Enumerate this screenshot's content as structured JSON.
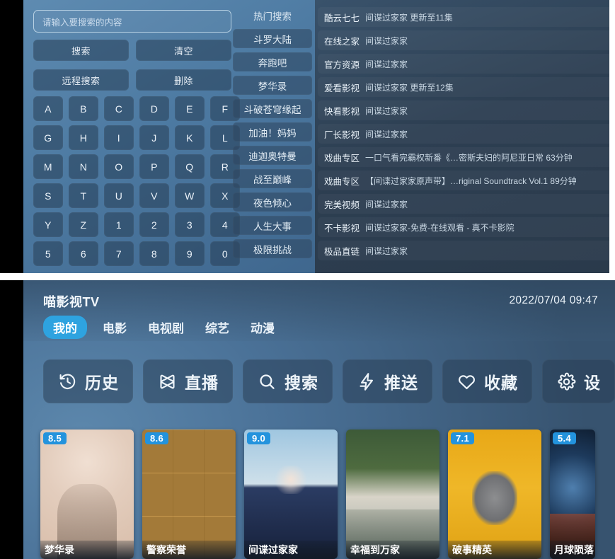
{
  "search_screen": {
    "input": {
      "placeholder": "请输入要搜索的内容",
      "value": ""
    },
    "buttons": [
      {
        "label": "搜索",
        "name": "search-button"
      },
      {
        "label": "清空",
        "name": "clear-button"
      },
      {
        "label": "远程搜索",
        "name": "remote-search-button"
      },
      {
        "label": "删除",
        "name": "delete-button"
      }
    ],
    "keypad": [
      "A",
      "B",
      "C",
      "D",
      "E",
      "F",
      "G",
      "H",
      "I",
      "J",
      "K",
      "L",
      "M",
      "N",
      "O",
      "P",
      "Q",
      "R",
      "S",
      "T",
      "U",
      "V",
      "W",
      "X",
      "Y",
      "Z",
      "1",
      "2",
      "3",
      "4",
      "5",
      "6",
      "7",
      "8",
      "9",
      "0"
    ],
    "hot_search": {
      "title": "热门搜索",
      "items": [
        "斗罗大陆",
        "奔跑吧",
        "梦华录",
        "斗破苍穹缘起",
        "加油！妈妈",
        "迪迦奥特曼",
        "战至巅峰",
        "夜色倾心",
        "人生大事",
        "极限挑战"
      ]
    },
    "results": [
      {
        "source": "酷云七七",
        "title": "间谍过家家  更新至11集"
      },
      {
        "source": "在线之家",
        "title": "间谍过家家"
      },
      {
        "source": "官方资源",
        "title": "间谍过家家"
      },
      {
        "source": "爱看影视",
        "title": "间谍过家家  更新至12集"
      },
      {
        "source": "快看影视",
        "title": "间谍过家家"
      },
      {
        "source": "厂长影视",
        "title": "间谍过家家"
      },
      {
        "source": "戏曲专区",
        "title": "一口气看完霸权新番《…密斯夫妇的阿尼亚日常  63分钟"
      },
      {
        "source": "戏曲专区",
        "title": "【间谍过家家原声带】…riginal Soundtrack Vol.1  89分钟"
      },
      {
        "source": "完美视频",
        "title": "间谍过家家"
      },
      {
        "source": "不卡影视",
        "title": "间谍过家家-免费-在线观看 - 真不卡影院"
      },
      {
        "source": "极品直链",
        "title": "间谍过家家"
      }
    ]
  },
  "tv_home": {
    "app_title": "喵影视TV",
    "clock": "2022/07/04 09:47",
    "tabs": [
      {
        "label": "我的",
        "active": true
      },
      {
        "label": "电影",
        "active": false
      },
      {
        "label": "电视剧",
        "active": false
      },
      {
        "label": "综艺",
        "active": false
      },
      {
        "label": "动漫",
        "active": false
      }
    ],
    "actions": [
      {
        "label": "历史",
        "icon": "history-icon"
      },
      {
        "label": "直播",
        "icon": "live-broadcast-icon"
      },
      {
        "label": "搜索",
        "icon": "search-icon"
      },
      {
        "label": "推送",
        "icon": "push-lightning-icon"
      },
      {
        "label": "收藏",
        "icon": "heart-icon"
      },
      {
        "label": "设",
        "icon": "gear-icon"
      }
    ],
    "posters": [
      {
        "score": "8.5",
        "title": "梦华录",
        "art": "art-menghualu"
      },
      {
        "score": "8.6",
        "title": "警察荣誉",
        "art": "art-jingcha"
      },
      {
        "score": "9.0",
        "title": "间谍过家家",
        "art": "art-spy"
      },
      {
        "score": "",
        "title": "幸福到万家",
        "art": "art-xingfu"
      },
      {
        "score": "7.1",
        "title": "破事精英",
        "art": "art-poshi"
      },
      {
        "score": "5.4",
        "title": "月球陨落",
        "art": "art-yueqiu"
      }
    ]
  },
  "colors": {
    "accent": "#2ea3e0",
    "score_badge": "#2393dd",
    "panel_blue": "#4d7ca4",
    "result_navy": "#2d3f52"
  }
}
